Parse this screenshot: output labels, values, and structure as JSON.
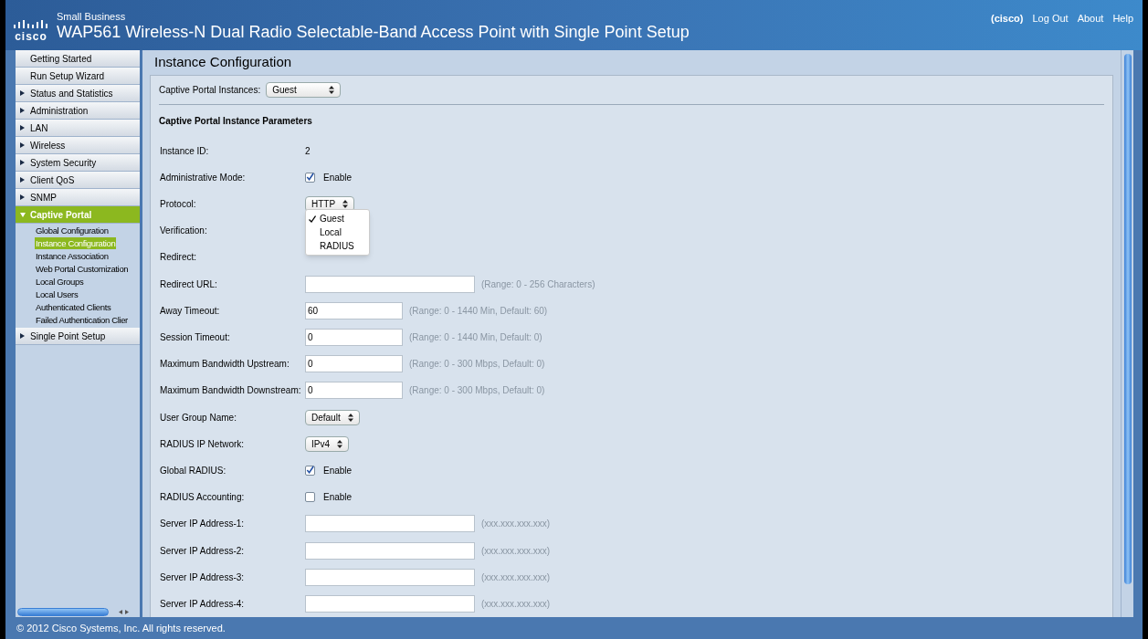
{
  "header": {
    "brand_line": "Small Business",
    "logo_text": "cisco",
    "title": "WAP561 Wireless-N Dual Radio Selectable-Band Access Point with Single Point Setup",
    "user": "(cisco)",
    "links": [
      "Log Out",
      "About",
      "Help"
    ]
  },
  "sidebar": {
    "items": [
      {
        "label": "Getting Started",
        "kind": "plain",
        "expanded": false
      },
      {
        "label": "Run Setup Wizard",
        "kind": "plain",
        "expanded": false
      },
      {
        "label": "Status and Statistics",
        "kind": "group",
        "expanded": false
      },
      {
        "label": "Administration",
        "kind": "group",
        "expanded": false
      },
      {
        "label": "LAN",
        "kind": "group",
        "expanded": false
      },
      {
        "label": "Wireless",
        "kind": "group",
        "expanded": false
      },
      {
        "label": "System Security",
        "kind": "group",
        "expanded": false
      },
      {
        "label": "Client QoS",
        "kind": "group",
        "expanded": false
      },
      {
        "label": "SNMP",
        "kind": "group",
        "expanded": false
      },
      {
        "label": "Captive Portal",
        "kind": "group",
        "expanded": true,
        "children": [
          {
            "label": "Global Configuration",
            "selected": false
          },
          {
            "label": "Instance Configuration",
            "selected": true
          },
          {
            "label": "Instance Association",
            "selected": false
          },
          {
            "label": "Web Portal Customization",
            "selected": false
          },
          {
            "label": "Local Groups",
            "selected": false
          },
          {
            "label": "Local Users",
            "selected": false
          },
          {
            "label": "Authenticated Clients",
            "selected": false
          },
          {
            "label": "Failed Authentication Clier",
            "selected": false
          }
        ]
      },
      {
        "label": "Single Point Setup",
        "kind": "group",
        "expanded": false
      }
    ]
  },
  "page": {
    "title": "Instance Configuration",
    "instances_label": "Captive Portal Instances:",
    "instances_value": "Guest",
    "section_title": "Captive Portal Instance Parameters",
    "rows": [
      {
        "label": "Instance ID:",
        "kind": "text",
        "value": "2"
      },
      {
        "label": "Administrative Mode:",
        "kind": "checkbox",
        "checked": true,
        "value": "Enable"
      },
      {
        "label": "Protocol:",
        "kind": "select",
        "value": "HTTP"
      },
      {
        "label": "Verification:",
        "kind": "open_select",
        "options": [
          {
            "label": "Guest",
            "selected": true
          },
          {
            "label": "Local",
            "selected": false
          },
          {
            "label": "RADIUS",
            "selected": false
          }
        ]
      },
      {
        "label": "Redirect:",
        "kind": "label"
      },
      {
        "label": "Redirect URL:",
        "kind": "wide_input",
        "value": "",
        "hint": "(Range: 0 - 256 Characters)"
      },
      {
        "label": "Away Timeout:",
        "kind": "short_input",
        "value": "60",
        "hint": "(Range: 0 - 1440 Min, Default: 60)"
      },
      {
        "label": "Session Timeout:",
        "kind": "short_input",
        "value": "0",
        "hint": "(Range: 0 - 1440 Min, Default: 0)"
      },
      {
        "label": "Maximum Bandwidth Upstream:",
        "kind": "short_input",
        "value": "0",
        "hint": "(Range: 0 - 300 Mbps, Default: 0)"
      },
      {
        "label": "Maximum Bandwidth Downstream:",
        "kind": "short_input",
        "value": "0",
        "hint": "(Range: 0 - 300 Mbps, Default: 0)"
      },
      {
        "label": "User Group Name:",
        "kind": "select",
        "value": "Default"
      },
      {
        "label": "RADIUS IP Network:",
        "kind": "select",
        "value": "IPv4"
      },
      {
        "label": "Global RADIUS:",
        "kind": "checkbox",
        "checked": true,
        "value": "Enable"
      },
      {
        "label": "RADIUS Accounting:",
        "kind": "checkbox",
        "checked": false,
        "value": "Enable"
      },
      {
        "label": "Server IP Address-1:",
        "kind": "wide_input",
        "value": "",
        "hint": "(xxx.xxx.xxx.xxx)"
      },
      {
        "label": "Server IP Address-2:",
        "kind": "wide_input",
        "value": "",
        "hint": "(xxx.xxx.xxx.xxx)"
      },
      {
        "label": "Server IP Address-3:",
        "kind": "wide_input",
        "value": "",
        "hint": "(xxx.xxx.xxx.xxx)"
      },
      {
        "label": "Server IP Address-4:",
        "kind": "wide_input",
        "value": "",
        "hint": "(xxx.xxx.xxx.xxx)"
      }
    ]
  },
  "footer": "© 2012 Cisco Systems, Inc. All rights reserved."
}
